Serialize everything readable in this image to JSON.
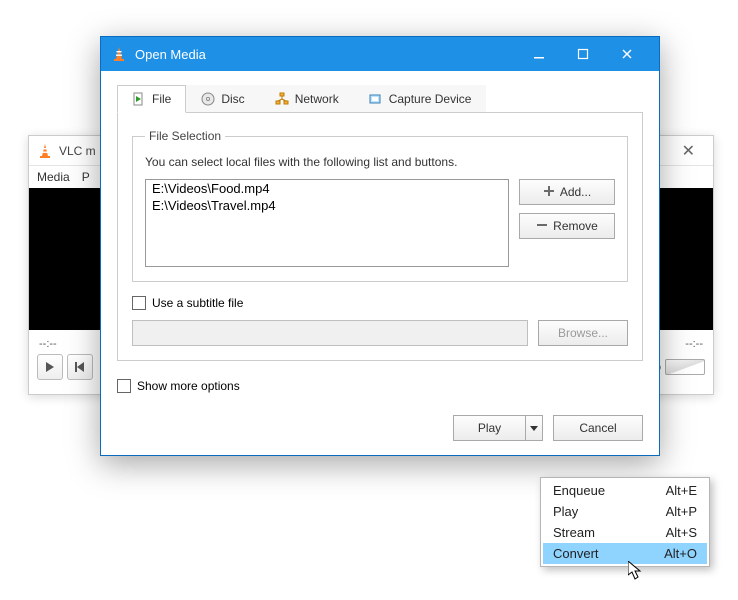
{
  "bg": {
    "title": "VLC m",
    "menu": {
      "media": "Media",
      "p": "P"
    },
    "time_left": "--:--",
    "time_right": "--:--",
    "volume_pct": "%"
  },
  "dialog": {
    "title": "Open Media",
    "tabs": {
      "file": "File",
      "disc": "Disc",
      "network": "Network",
      "capture": "Capture Device"
    },
    "fileset": {
      "legend": "File Selection",
      "desc": "You can select local files with the following list and buttons.",
      "items": [
        "E:\\Videos\\Food.mp4",
        "E:\\Videos\\Travel.mp4"
      ],
      "add": "Add...",
      "remove": "Remove"
    },
    "subtitle_checkbox": "Use a subtitle file",
    "browse": "Browse...",
    "more": "Show more options",
    "play": "Play",
    "cancel": "Cancel"
  },
  "menu": {
    "items": [
      {
        "label": "Enqueue",
        "accel": "Alt+E"
      },
      {
        "label": "Play",
        "accel": "Alt+P"
      },
      {
        "label": "Stream",
        "accel": "Alt+S"
      },
      {
        "label": "Convert",
        "accel": "Alt+O",
        "hl": true
      }
    ]
  }
}
